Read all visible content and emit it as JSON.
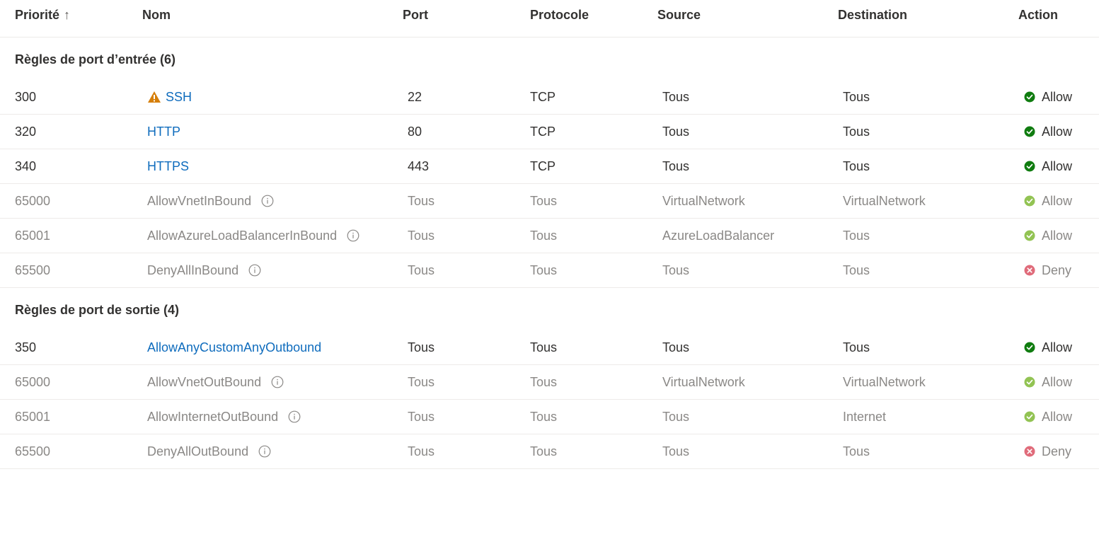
{
  "columns": {
    "priority": "Priorité",
    "priority_sort": "↑",
    "name": "Nom",
    "port": "Port",
    "protocol": "Protocole",
    "source": "Source",
    "destination": "Destination",
    "action": "Action"
  },
  "colors": {
    "link": "#0f6cbd",
    "allow": "#107c10",
    "allow_muted": "#92c353",
    "deny": "#e06b7a",
    "warning": "#d67f0a",
    "muted_text": "#8a8886"
  },
  "inbound": {
    "title": "Règles de port d’entrée (6)",
    "rules": [
      {
        "priority": "300",
        "name": "SSH",
        "port": "22",
        "protocol": "TCP",
        "source": "Tous",
        "destination": "Tous",
        "action": "Allow"
      },
      {
        "priority": "320",
        "name": "HTTP",
        "port": "80",
        "protocol": "TCP",
        "source": "Tous",
        "destination": "Tous",
        "action": "Allow"
      },
      {
        "priority": "340",
        "name": "HTTPS",
        "port": "443",
        "protocol": "TCP",
        "source": "Tous",
        "destination": "Tous",
        "action": "Allow"
      },
      {
        "priority": "65000",
        "name": "AllowVnetInBound",
        "port": "Tous",
        "protocol": "Tous",
        "source": "VirtualNetwork",
        "destination": "VirtualNetwork",
        "action": "Allow"
      },
      {
        "priority": "65001",
        "name": "AllowAzureLoadBalancerInBound",
        "port": "Tous",
        "protocol": "Tous",
        "source": "AzureLoadBalancer",
        "destination": "Tous",
        "action": "Allow"
      },
      {
        "priority": "65500",
        "name": "DenyAllInBound",
        "port": "Tous",
        "protocol": "Tous",
        "source": "Tous",
        "destination": "Tous",
        "action": "Deny"
      }
    ]
  },
  "outbound": {
    "title": "Règles de port de sortie (4)",
    "rules": [
      {
        "priority": "350",
        "name": "AllowAnyCustomAnyOutbound",
        "port": "Tous",
        "protocol": "Tous",
        "source": "Tous",
        "destination": "Tous",
        "action": "Allow"
      },
      {
        "priority": "65000",
        "name": "AllowVnetOutBound",
        "port": "Tous",
        "protocol": "Tous",
        "source": "VirtualNetwork",
        "destination": "VirtualNetwork",
        "action": "Allow"
      },
      {
        "priority": "65001",
        "name": "AllowInternetOutBound",
        "port": "Tous",
        "protocol": "Tous",
        "source": "Tous",
        "destination": "Internet",
        "action": "Allow"
      },
      {
        "priority": "65500",
        "name": "DenyAllOutBound",
        "port": "Tous",
        "protocol": "Tous",
        "source": "Tous",
        "destination": "Tous",
        "action": "Deny"
      }
    ]
  }
}
